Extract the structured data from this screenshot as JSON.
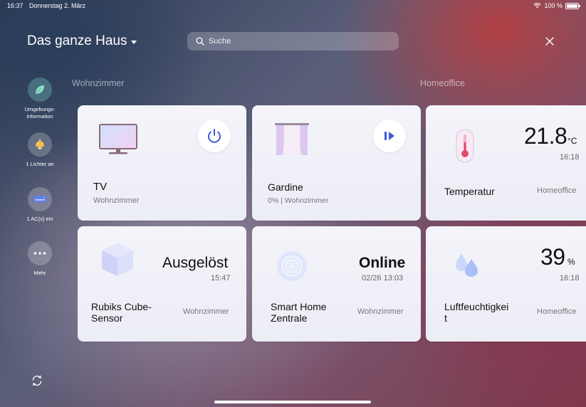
{
  "status_bar": {
    "time": "16:37",
    "date": "Donnerstag 2. März",
    "battery": "100 %"
  },
  "header": {
    "home_title": "Das ganze Haus",
    "search_placeholder": "Suche"
  },
  "sidebar": {
    "items": [
      {
        "label": "Umgebungs-\ninformation",
        "icon": "leaf-icon"
      },
      {
        "label": "1 Lichter an",
        "icon": "ceiling-lamp-icon"
      },
      {
        "label": "1 AC(s) ein",
        "icon": "air-conditioner-icon"
      },
      {
        "label": "Mehr",
        "icon": "more-dots-icon"
      }
    ]
  },
  "sections": {
    "living_room": "Wohnzimmer",
    "home_office": "Homeoffice"
  },
  "cards": {
    "tv": {
      "title": "TV",
      "room": "Wohnzimmer"
    },
    "curtain": {
      "title": "Gardine",
      "status": "0% | Wohnzimmer"
    },
    "temperature": {
      "title": "Temperatur",
      "room": "Homeoffice",
      "value": "21.8",
      "unit": "°C",
      "time": "16:18"
    },
    "cube": {
      "title": "Rubiks Cube-\nSensor",
      "room": "Wohnzimmer",
      "state": "Ausgelöst",
      "time": "15:47"
    },
    "hub": {
      "title": "Smart Home\nZentrale",
      "room": "Wohnzimmer",
      "state": "Online",
      "time": "02/26 13:03"
    },
    "humidity": {
      "title": "Luftfeuchtigkei\nt",
      "room": "Homeoffice",
      "value": "39",
      "unit": "%",
      "time": "16:18"
    }
  },
  "colors": {
    "accent": "#3d5bd9",
    "card_bg": "#f1f2f8"
  }
}
